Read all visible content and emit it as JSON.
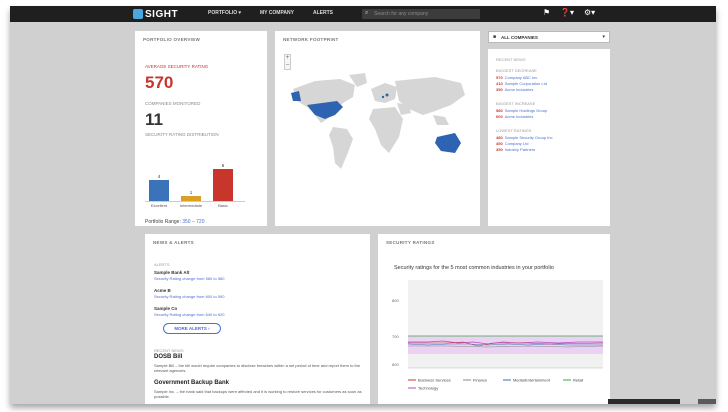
{
  "header": {
    "brand": "SIGHT",
    "nav": [
      "PORTFOLIO ▾",
      "MY COMPANY",
      "ALERTS"
    ],
    "search_placeholder": "Search for any company",
    "search_icon": "search-icon",
    "icons": [
      "flag-icon",
      "help-icon",
      "settings-icon"
    ]
  },
  "portfolio": {
    "title": "PORTFOLIO OVERVIEW",
    "avg_label": "AVERAGE SECURITY RATING",
    "avg_value": "570",
    "companies_label": "COMPANIES MONITORED",
    "companies_value": "11",
    "dist_label": "SECURITY RATING DISTRIBUTION",
    "range_label": "Portfolio Range:",
    "range_value": "350 – 720"
  },
  "chart_data": {
    "type": "bar",
    "categories": [
      "Excellent",
      "Intermediate",
      "Basic"
    ],
    "values": [
      4,
      1,
      6
    ],
    "colors": [
      "#3a73b8",
      "#d8a025",
      "#c8352d"
    ]
  },
  "map": {
    "title": "NETWORK FOOTPRINT",
    "zoom_in": "+",
    "zoom_out": "–"
  },
  "companies": {
    "select_value": "ALL COMPANIES",
    "title": "RECENT NEWS",
    "groups": [
      {
        "title": "BIGGEST DECREASE",
        "items": [
          {
            "n": "570",
            "t": "Company ABC Inc"
          },
          {
            "n": "410",
            "t": "Sample Corporation Ltd"
          },
          {
            "n": "350",
            "t": "Acme Industries"
          }
        ]
      },
      {
        "title": "BIGGEST INCREASE",
        "items": [
          {
            "n": "580",
            "t": "Sample Holdings Group"
          },
          {
            "n": "600",
            "t": "Acme Industries"
          }
        ]
      },
      {
        "title": "LOWEST RATINGS",
        "items": [
          {
            "n": "480",
            "t": "Sample Security Group Inc"
          },
          {
            "n": "450",
            "t": "Company Ltd"
          },
          {
            "n": "350",
            "t": "Industry Partners"
          }
        ]
      }
    ]
  },
  "news": {
    "title": "NEWS & ALERTS",
    "alerts_label": "ALERTS",
    "alerts": [
      {
        "head": "Sample Bank Alt",
        "line": "Security Rating change from 560 to 580"
      },
      {
        "head": "Acme B",
        "line": "Security Rating change from 600 to 590"
      },
      {
        "head": "Sample Co",
        "line": "Security Rating change from 640 to 620"
      }
    ],
    "more_button": "MORE ALERTS",
    "news_label": "RECENT NEWS",
    "items": [
      {
        "head": "DOSB Bill",
        "body": "Sample Bill – the bill would require companies to disclose breaches within a set period of time and report them to the relevant agencies."
      },
      {
        "head": "Government Backup Bank",
        "body": "Sample Inc. – the bank said that backups were affected and it is working to restore services for customers as soon as possible."
      }
    ]
  },
  "ratings": {
    "title": "SECURITY RATINGS",
    "description": "Security ratings for the 5 most common industries in your portfolio",
    "y_ticks": [
      "800",
      "700",
      "600"
    ],
    "legend": [
      "Business Services",
      "Finance",
      "Media/Entertainment",
      "Retail",
      "Technology"
    ],
    "legend_colors": [
      "#c8352d",
      "#8a8a8a",
      "#3a73b8",
      "#3aa64a",
      "#b04fc8"
    ]
  }
}
